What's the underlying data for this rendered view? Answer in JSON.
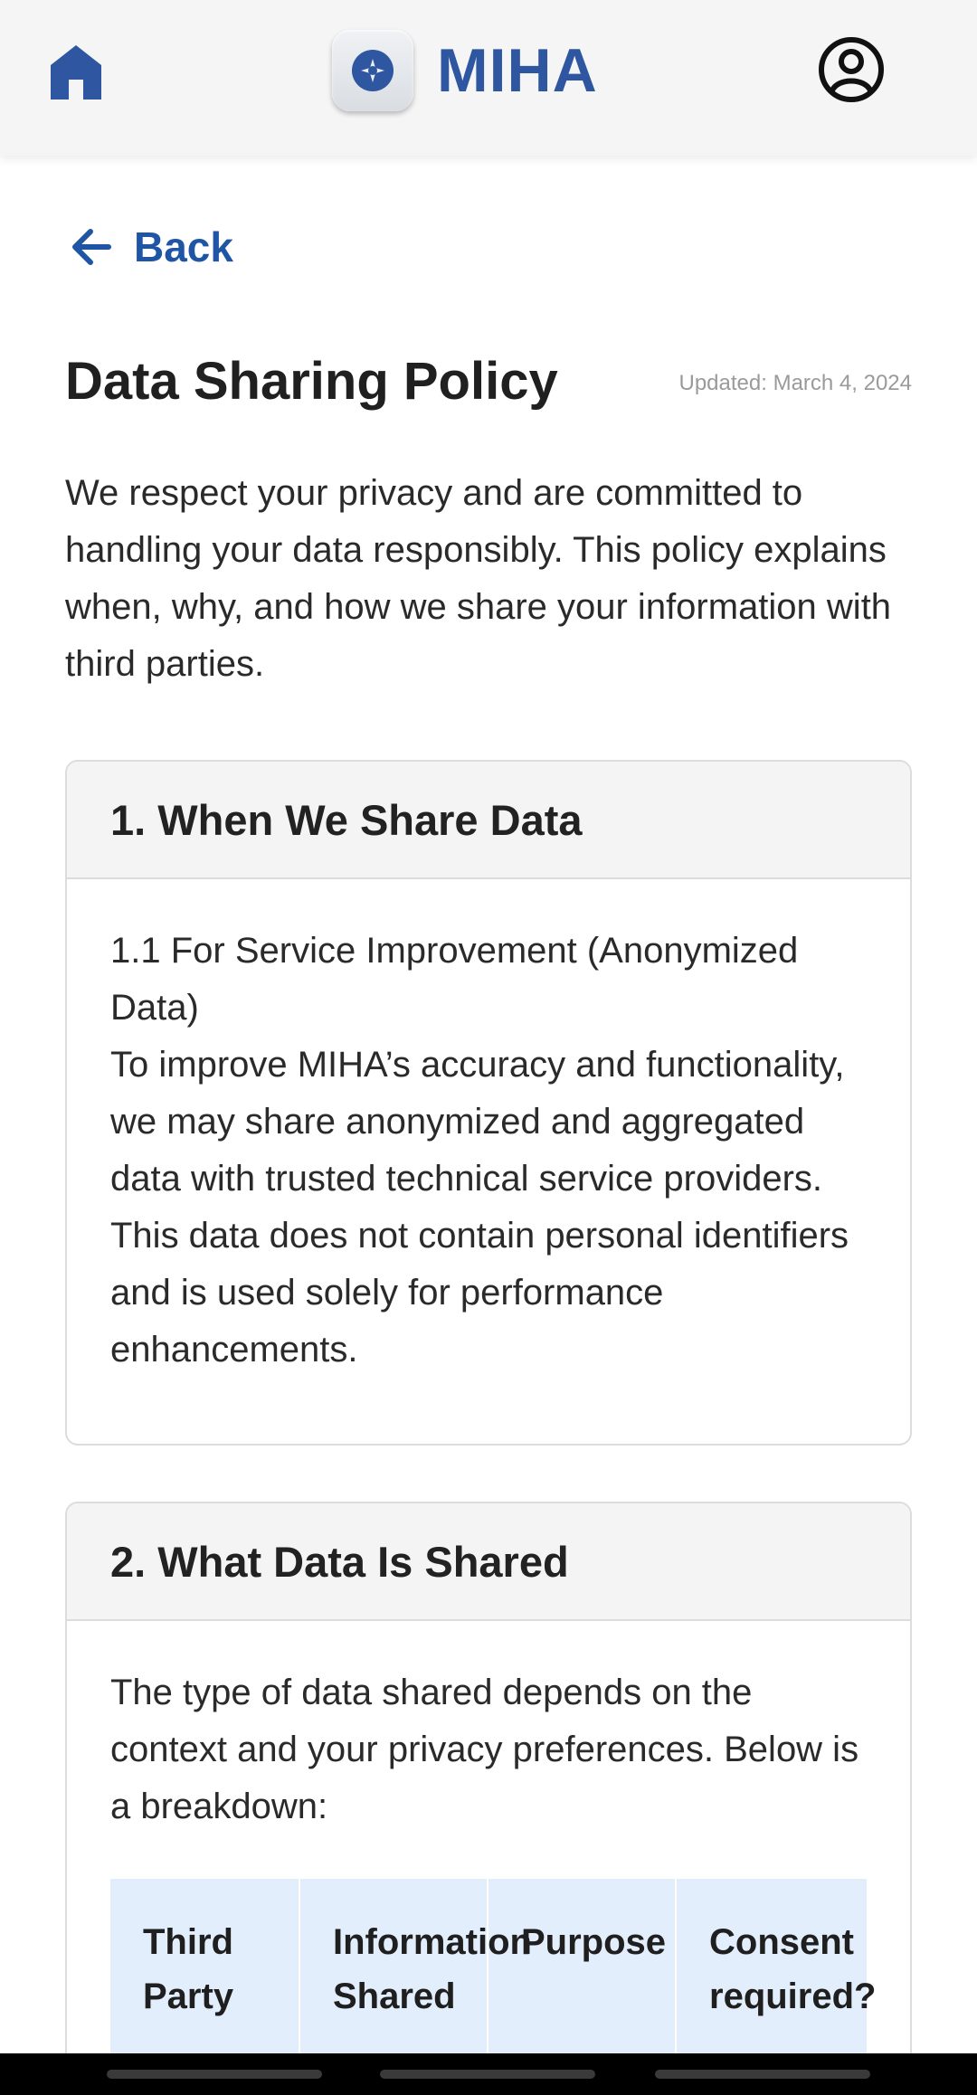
{
  "header": {
    "home_icon": "home-icon",
    "logo_text": "MIHA",
    "profile_icon": "account-circle-icon",
    "brand_color": "#2f56a1"
  },
  "nav": {
    "back_label": "Back",
    "back_icon": "arrow-left-icon"
  },
  "page": {
    "title": "Data Sharing Policy",
    "updated": "Updated: March 4, 2024",
    "intro": "We respect your privacy and are committed to handling your data responsibly. This policy explains when, why, and how we share your information with third parties."
  },
  "sections": [
    {
      "title": "1. When We Share Data",
      "subtitle": "1.1 For Service Improvement (Anonymized Data)",
      "body": "To improve MIHA’s accuracy and functionality, we may share anonymized and aggregated data with trusted technical service providers. This data does not contain personal identifiers and is used solely for performance enhancements."
    },
    {
      "title": "2. What Data Is Shared",
      "body": "The type of data shared depends on the context and your privacy preferences. Below is a breakdown:",
      "table_headers": [
        "Third Party",
        "Information Shared",
        "Purpose",
        "Consent required?"
      ]
    }
  ]
}
